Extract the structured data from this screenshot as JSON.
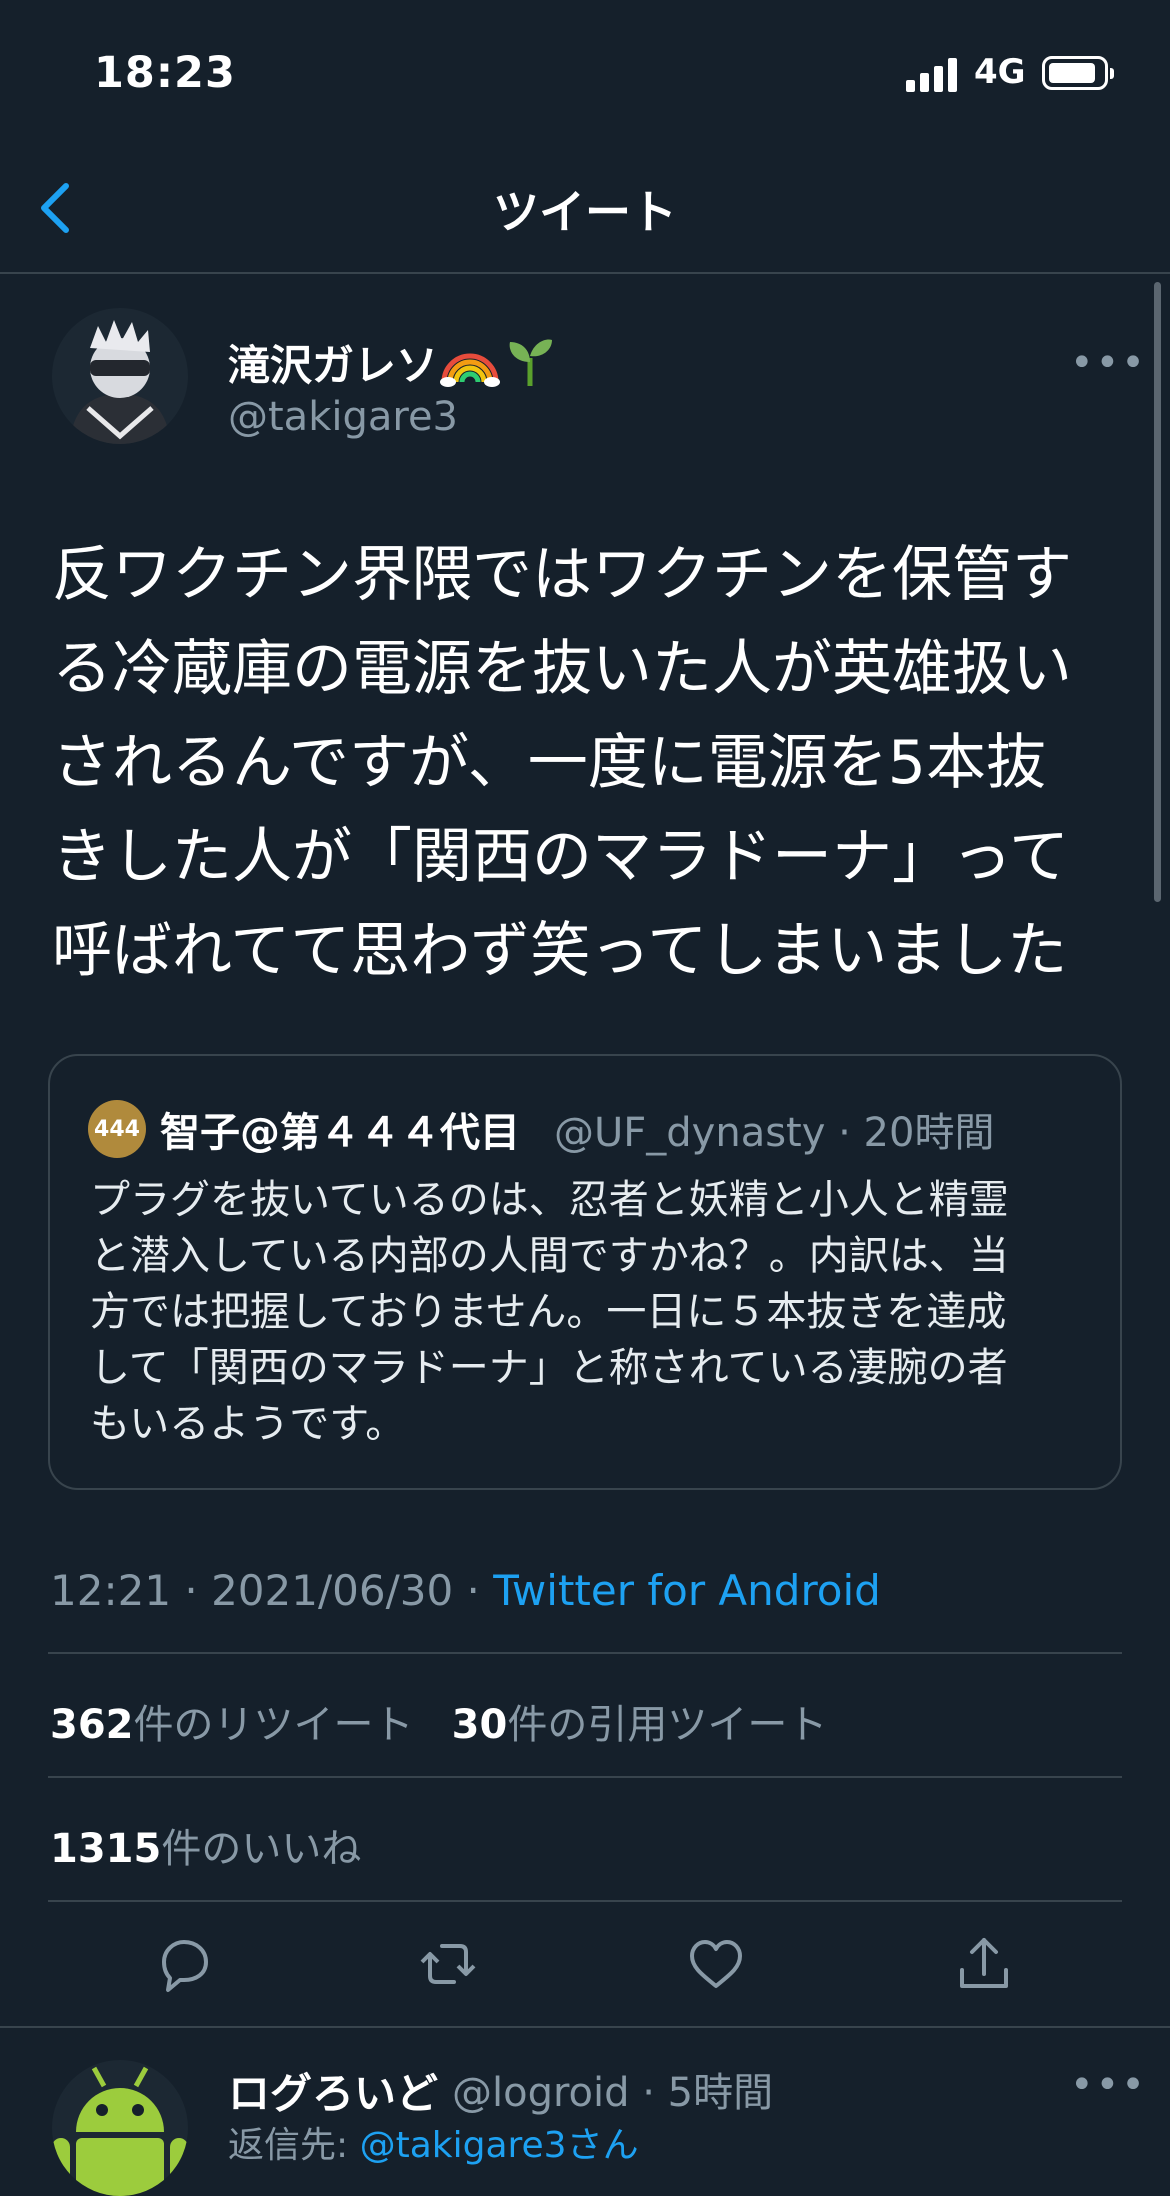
{
  "status_bar": {
    "time": "18:23",
    "network": "4G"
  },
  "header": {
    "title": "ツイート"
  },
  "tweet": {
    "author_name": "滝沢ガレソ",
    "author_handle": "@takigare3",
    "author_emoji_icons": [
      "rainbow-icon",
      "seedling-icon"
    ],
    "lines": [
      "反ワクチン界隈ではワクチンを保管す",
      "る冷蔵庫の電源を抜いた人が英雄扱い",
      "されるんですが、一度に電源を5本抜",
      "きした人が「関西のマラドーナ」って",
      "呼ばれてて思わず笑ってしまいました"
    ],
    "timestamp": "12:21 · 2021/06/30 · ",
    "source": "Twitter for Android"
  },
  "quoted_tweet": {
    "avatar_text": "444",
    "author_name": "智子@第４４４代目",
    "author_handle": "@UF_dynasty · 20時間",
    "lines": [
      "プラグを抜いているのは、忍者と妖精と小人と精霊",
      "と潜入している内部の人間ですかね？。内訳は、当",
      "方では把握しておりません。一日に５本抜きを達成",
      "して「関西のマラドーナ」と称されている凄腕の者",
      "もいるようです。"
    ]
  },
  "stats": {
    "retweets_count": "362",
    "retweets_label": "件のリツイート",
    "quotes_count": "30",
    "quotes_label": "件の引用ツイート",
    "likes_count": "1315",
    "likes_label": "件のいいね"
  },
  "actions": [
    "reply-icon",
    "retweet-icon",
    "like-icon",
    "share-icon"
  ],
  "reply": {
    "author_name": "ログろいど",
    "author_handle": "@logroid · 5時間",
    "sub_prefix": "返信先: ",
    "sub_handle": "@takigare3さん"
  },
  "colors": {
    "background": "#15202b",
    "border": "#38444d",
    "secondary_text": "#8899a6",
    "accent": "#1da1f2"
  }
}
